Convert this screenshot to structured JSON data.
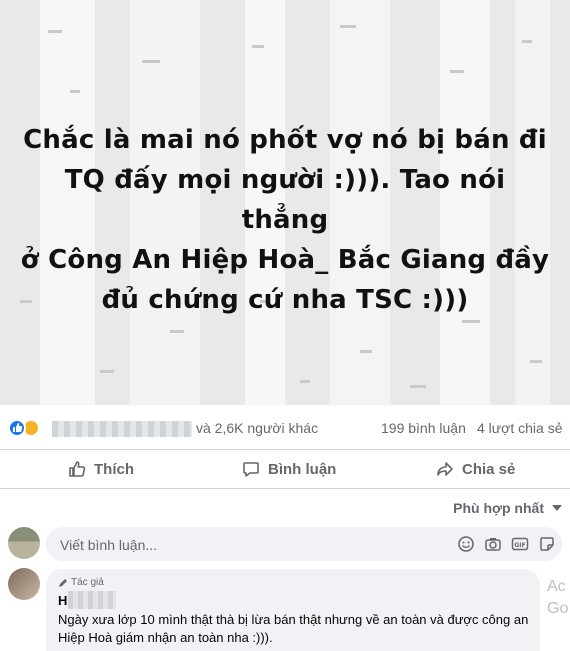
{
  "post": {
    "text": "Chắc là mai nó phốt vợ nó bị bán đi\nTQ đấy mọi người :))). Tao nói thẳng\nở Công An Hiệp Hoà_ Bắc Giang đầy\nđủ chứng cứ nha TSC :)))",
    "background": "#e9e9e9"
  },
  "reactions": {
    "icons": [
      "like-icon",
      "haha-icon"
    ],
    "others_text": "và 2,6K người khác",
    "comment_count": "199 bình luận",
    "share_count": "4 lượt chia sẻ"
  },
  "actions": {
    "like_label": "Thích",
    "comment_label": "Bình luận",
    "share_label": "Chia sẻ"
  },
  "sort": {
    "label": "Phù hợp nhất"
  },
  "comment_input": {
    "placeholder": "Viết bình luận...",
    "icons": [
      "emoji-icon",
      "camera-icon",
      "gif-icon",
      "sticker-icon"
    ]
  },
  "comments": [
    {
      "author_tag": "Tác giả",
      "author_initial": "H",
      "text": "Ngày xưa lớp 10 mình thật thà bị lừa bán thật nhưng về an toàn và được công an Hiệp Hoà giám nhận an toàn nha :)))."
    }
  ],
  "side_actions": [
    "Ac",
    "Go"
  ],
  "colors": {
    "accent": "#1877f2",
    "secondary_text": "#65676b"
  }
}
